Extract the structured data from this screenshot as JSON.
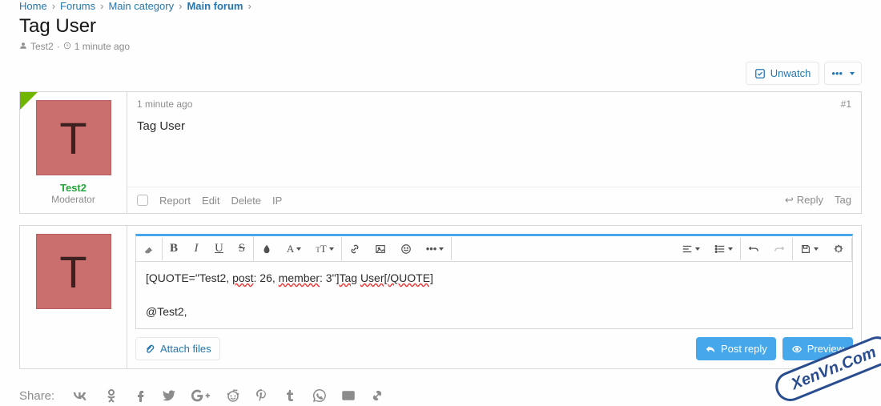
{
  "breadcrumb": {
    "items": [
      {
        "label": "Home"
      },
      {
        "label": "Forums"
      },
      {
        "label": "Main category"
      },
      {
        "label": "Main forum"
      }
    ]
  },
  "thread": {
    "title": "Tag User",
    "author": "Test2",
    "time": "1 minute ago"
  },
  "topbar": {
    "unwatch": "Unwatch",
    "more": "•••"
  },
  "post": {
    "avatar_letter": "T",
    "username": "Test2",
    "usertitle": "Moderator",
    "time": "1 minute ago",
    "number": "#1",
    "body": "Tag User",
    "actions": {
      "report": "Report",
      "edit": "Edit",
      "delete": "Delete",
      "ip": "IP",
      "reply": "Reply",
      "tag": "Tag"
    }
  },
  "editor": {
    "avatar_letter": "T",
    "content_line1_a": "[QUOTE=\"Test2, ",
    "content_line1_b": "post",
    "content_line1_c": ": 26, ",
    "content_line1_d": "member",
    "content_line1_e": ": 3\"]",
    "content_line1_f": "Tag",
    "content_line1_g": " ",
    "content_line1_h": "User[/QUOTE]",
    "content_line2": "@Test2,",
    "attach": "Attach files",
    "post_reply": "Post reply",
    "preview": "Preview"
  },
  "share": {
    "label": "Share:"
  },
  "watermark": "XenVn.Com"
}
